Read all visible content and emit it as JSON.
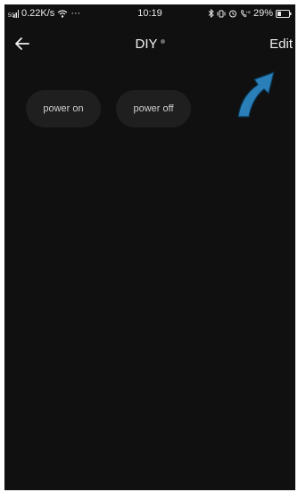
{
  "status_bar": {
    "network_speed": "0.22K/s",
    "more": "···",
    "time": "10:19",
    "battery": "29%",
    "icons": [
      "signal-icon",
      "wifi-icon",
      "bluetooth-icon",
      "vibrate-icon",
      "alarm-icon",
      "hd-call-icon",
      "battery-icon"
    ]
  },
  "header": {
    "title": "DIY",
    "edit_label": "Edit",
    "back_icon": "back-arrow-icon"
  },
  "buttons": [
    {
      "label": "power on"
    },
    {
      "label": "power off"
    }
  ],
  "colors": {
    "background": "#101010",
    "chip": "#1f1f1f",
    "annotation_arrow": "#2a7fb8",
    "text": "#f2f2f2"
  }
}
